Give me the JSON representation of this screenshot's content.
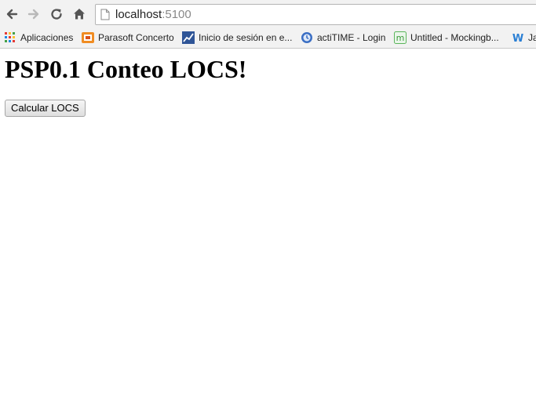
{
  "browser": {
    "url_host": "localhost",
    "url_port": ":5100",
    "bookmarks": [
      {
        "label": "Aplicaciones",
        "icon": "apps-grid-icon"
      },
      {
        "label": "Parasoft Concerto",
        "icon": "parasoft-icon"
      },
      {
        "label": "Inicio de sesión en e...",
        "icon": "login-chart-icon"
      },
      {
        "label": "actiTIME - Login",
        "icon": "actitime-icon"
      },
      {
        "label": "Untitled - Mockingb...",
        "icon": "mockingbird-icon"
      },
      {
        "label": "Ja",
        "icon": "w-icon"
      }
    ]
  },
  "page": {
    "title": "PSP0.1 Conteo LOCS!",
    "button_label": "Calcular LOCS"
  },
  "colors": {
    "chrome_bg": "#f2f2f2",
    "page_bg": "#ffffff",
    "apps_colors": [
      "#e53935",
      "#fbc02d",
      "#43a047",
      "#1e88e5"
    ]
  }
}
